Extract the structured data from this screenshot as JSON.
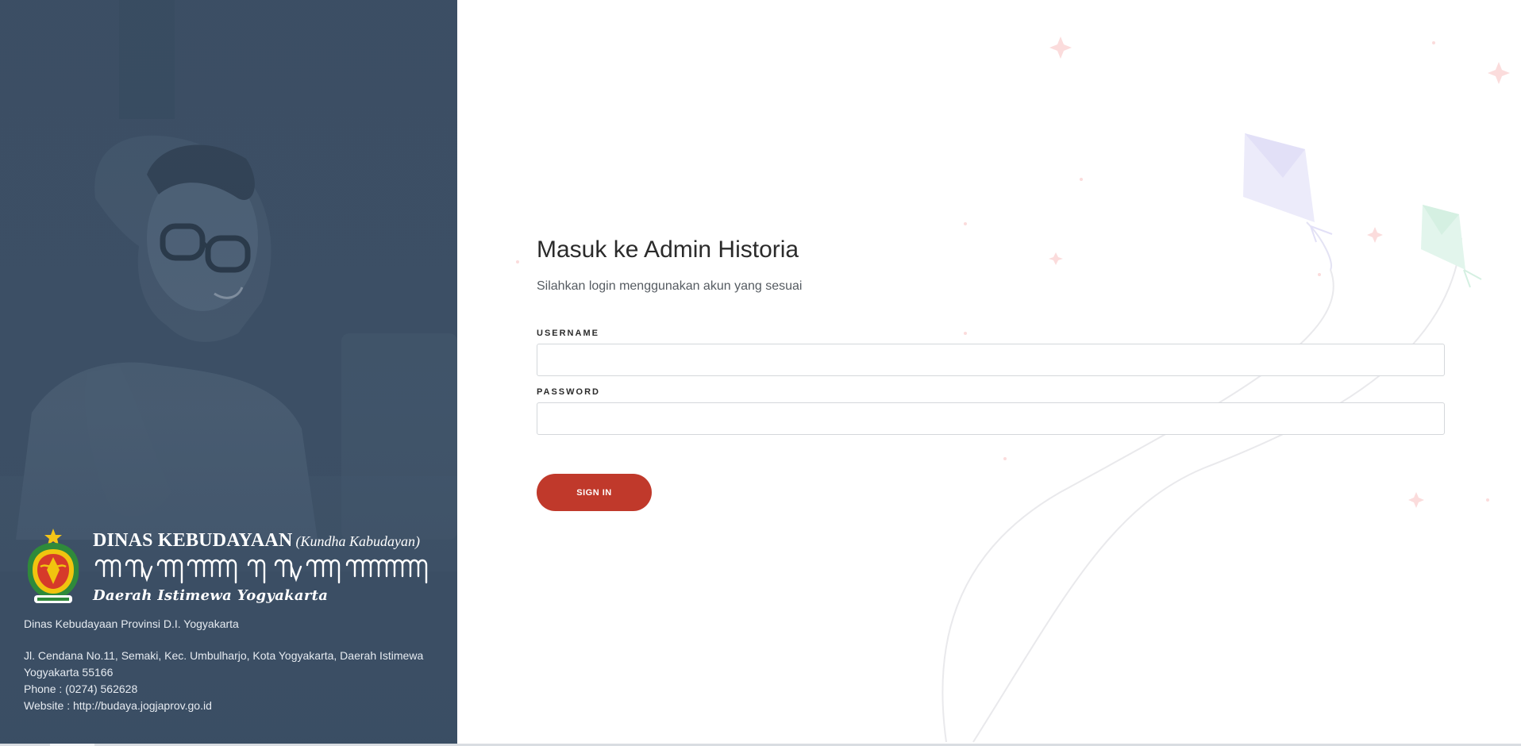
{
  "left_panel": {
    "brand": {
      "title": "DINAS KEBUDAYAAN",
      "subtitle": "(Kundha Kabudayan)",
      "region": "Daerah Istimewa Yogyakarta"
    },
    "org": {
      "name": "Dinas Kebudayaan Provinsi D.I. Yogyakarta",
      "address": "Jl. Cendana No.11, Semaki, Kec. Umbulharjo, Kota Yogyakarta, Daerah Istimewa Yogyakarta 55166",
      "phone": "Phone : (0274) 562628",
      "website": "Website : http://budaya.jogjaprov.go.id"
    },
    "overlay_color": "#3a4d63"
  },
  "login": {
    "title": "Masuk ke Admin Historia",
    "subtitle": "Silahkan login menggunakan akun yang sesuai",
    "username_label": "Username",
    "username_value": "",
    "password_label": "Password",
    "password_value": "",
    "signin_label": "SIGN IN",
    "accent_color": "#c0392b"
  }
}
